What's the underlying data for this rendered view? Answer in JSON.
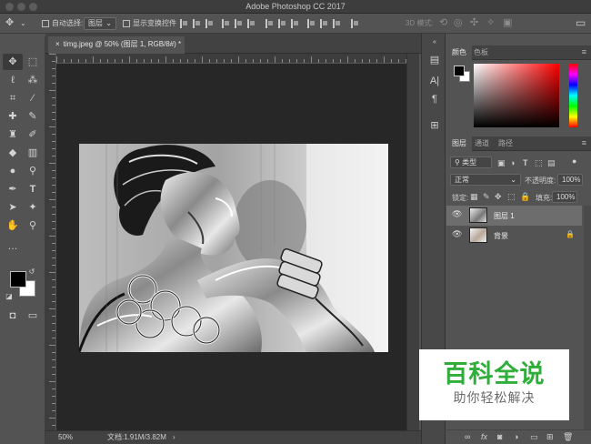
{
  "app": {
    "title": "Adobe Photoshop CC 2017"
  },
  "options_bar": {
    "auto_select_label": "自动选择:",
    "auto_select_value": "图层",
    "show_transform_label": "显示变换控件",
    "mode_3d_label": "3D 模式:"
  },
  "document": {
    "tab_title": "timg.jpeg @ 50% (图层 1, RGB/8#) *",
    "zoom": "50%",
    "doc_size": "文档:1.91M/3.82M"
  },
  "color_panel": {
    "tabs": [
      "颜色",
      "色板"
    ]
  },
  "layers_panel": {
    "tabs": [
      "图层",
      "通道",
      "路径"
    ],
    "filter_kind": "类型",
    "blend_mode": "正常",
    "opacity_label": "不透明度:",
    "opacity_value": "100%",
    "lock_label": "锁定:",
    "fill_label": "填充:",
    "fill_value": "100%",
    "layers": [
      {
        "name": "图层 1",
        "selected": true
      },
      {
        "name": "背景",
        "locked": true
      }
    ]
  },
  "watermark": {
    "title": "百科全说",
    "subtitle": "助你轻松解决"
  }
}
